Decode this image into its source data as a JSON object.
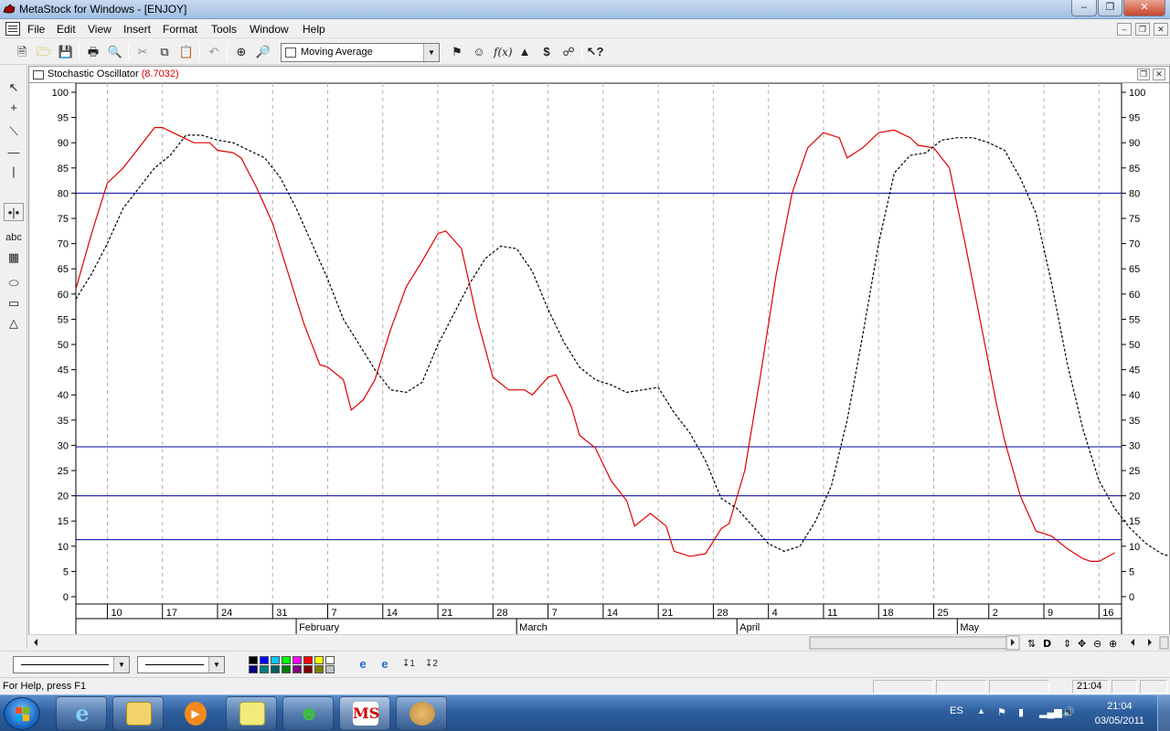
{
  "window": {
    "title": "MetaStock for Windows - [ENJOY]"
  },
  "menu": [
    "File",
    "Edit",
    "View",
    "Insert",
    "Format",
    "Tools",
    "Window",
    "Help"
  ],
  "toolbar": {
    "indicator_select": "Moving Average"
  },
  "chart_window": {
    "title": "Stochastic Oscillator",
    "value": "(8.7032)"
  },
  "chart_data": {
    "type": "line",
    "title": "Stochastic Oscillator",
    "ylim": [
      0,
      100
    ],
    "yticks": [
      0,
      5,
      10,
      15,
      20,
      25,
      30,
      35,
      40,
      45,
      50,
      55,
      60,
      65,
      70,
      75,
      80,
      85,
      90,
      95,
      100
    ],
    "xlim": [
      0,
      140
    ],
    "x_ticks": [
      {
        "x": 4,
        "label": "10"
      },
      {
        "x": 11,
        "label": "17"
      },
      {
        "x": 18,
        "label": "24"
      },
      {
        "x": 25,
        "label": "31"
      },
      {
        "x": 32,
        "label": "7"
      },
      {
        "x": 39,
        "label": "14"
      },
      {
        "x": 46,
        "label": "21"
      },
      {
        "x": 53,
        "label": "28"
      },
      {
        "x": 60,
        "label": "7"
      },
      {
        "x": 67,
        "label": "14"
      },
      {
        "x": 74,
        "label": "21"
      },
      {
        "x": 81,
        "label": "28"
      },
      {
        "x": 88,
        "label": "4"
      },
      {
        "x": 95,
        "label": "11"
      },
      {
        "x": 102,
        "label": "18"
      },
      {
        "x": 109,
        "label": "25"
      },
      {
        "x": 116,
        "label": "2"
      },
      {
        "x": 123,
        "label": "9"
      },
      {
        "x": 130,
        "label": "16"
      }
    ],
    "months": [
      {
        "x": 28,
        "label": "February"
      },
      {
        "x": 56,
        "label": "March"
      },
      {
        "x": 84,
        "label": "April"
      },
      {
        "x": 112,
        "label": "May"
      }
    ],
    "hlines": [
      {
        "y": 80,
        "color": "#0000a0"
      },
      {
        "y": 29.7,
        "color": "#0000a0"
      },
      {
        "y": 20,
        "color": "#0000a0"
      },
      {
        "y": 11.3,
        "color": "#0000a0"
      }
    ],
    "series": [
      {
        "style": "solid",
        "color": "#e00000",
        "points": [
          [
            0,
            61
          ],
          [
            2,
            72
          ],
          [
            4,
            82
          ],
          [
            6,
            85
          ],
          [
            8,
            89
          ],
          [
            10,
            93
          ],
          [
            11,
            93
          ],
          [
            13,
            91.5
          ],
          [
            15,
            90
          ],
          [
            17,
            90
          ],
          [
            18,
            88.5
          ],
          [
            20,
            88
          ],
          [
            21,
            87
          ],
          [
            23,
            81
          ],
          [
            25,
            74
          ],
          [
            27,
            64
          ],
          [
            29,
            54
          ],
          [
            31,
            46
          ],
          [
            32,
            45.5
          ],
          [
            34,
            43
          ],
          [
            35,
            37
          ],
          [
            36.5,
            39
          ],
          [
            38,
            43
          ],
          [
            40,
            53
          ],
          [
            42,
            61.5
          ],
          [
            44,
            66.5
          ],
          [
            46,
            72
          ],
          [
            47,
            72.5
          ],
          [
            49,
            69
          ],
          [
            51,
            55
          ],
          [
            53,
            43.5
          ],
          [
            55,
            41
          ],
          [
            57,
            41
          ],
          [
            58,
            40
          ],
          [
            60,
            43.5
          ],
          [
            61,
            44
          ],
          [
            63,
            37.5
          ],
          [
            64,
            32
          ],
          [
            66,
            29.5
          ],
          [
            68,
            23
          ],
          [
            70,
            19
          ],
          [
            71,
            14
          ],
          [
            73,
            16.5
          ],
          [
            75,
            14
          ],
          [
            76,
            9
          ],
          [
            78,
            8
          ],
          [
            80,
            8.5
          ],
          [
            82,
            13.5
          ],
          [
            83,
            14.5
          ],
          [
            85,
            25
          ],
          [
            87,
            44
          ],
          [
            89,
            64
          ],
          [
            91,
            80
          ],
          [
            93,
            89
          ],
          [
            95,
            92
          ],
          [
            97,
            91
          ],
          [
            98,
            87
          ],
          [
            100,
            89
          ],
          [
            102,
            92
          ],
          [
            104,
            92.5
          ],
          [
            106,
            91
          ],
          [
            107,
            89.5
          ],
          [
            109,
            89
          ],
          [
            111,
            85
          ],
          [
            113,
            70
          ],
          [
            115,
            54
          ],
          [
            117,
            38
          ],
          [
            118,
            31
          ],
          [
            120,
            20
          ],
          [
            122,
            13
          ],
          [
            124,
            12
          ],
          [
            126,
            9.5
          ],
          [
            128,
            7.5
          ],
          [
            129,
            7
          ],
          [
            130,
            7
          ],
          [
            132,
            8.7
          ]
        ]
      },
      {
        "style": "dashed",
        "color": "#000000",
        "points": [
          [
            0,
            59
          ],
          [
            2,
            64
          ],
          [
            4,
            70
          ],
          [
            6,
            77
          ],
          [
            8,
            81
          ],
          [
            10,
            85
          ],
          [
            12,
            87.5
          ],
          [
            14,
            91.5
          ],
          [
            16,
            91.5
          ],
          [
            18,
            90.5
          ],
          [
            20,
            90
          ],
          [
            22,
            88.5
          ],
          [
            24,
            87
          ],
          [
            26,
            83
          ],
          [
            28,
            77
          ],
          [
            30,
            70
          ],
          [
            32,
            63
          ],
          [
            34,
            55
          ],
          [
            36,
            50
          ],
          [
            38,
            45
          ],
          [
            40,
            41
          ],
          [
            42,
            40.5
          ],
          [
            44,
            42.5
          ],
          [
            46,
            50
          ],
          [
            48,
            56
          ],
          [
            50,
            62
          ],
          [
            52,
            67
          ],
          [
            54,
            69.5
          ],
          [
            56,
            69
          ],
          [
            58,
            64.5
          ],
          [
            60,
            57
          ],
          [
            62,
            50.5
          ],
          [
            64,
            45.5
          ],
          [
            66,
            43
          ],
          [
            68,
            42
          ],
          [
            70,
            40.5
          ],
          [
            72,
            41
          ],
          [
            74,
            41.5
          ],
          [
            76,
            36.5
          ],
          [
            78,
            32.5
          ],
          [
            80,
            27
          ],
          [
            82,
            19.5
          ],
          [
            84,
            17.5
          ],
          [
            86,
            14
          ],
          [
            88,
            10.5
          ],
          [
            90,
            9
          ],
          [
            92,
            10
          ],
          [
            94,
            15
          ],
          [
            96,
            22
          ],
          [
            98,
            35
          ],
          [
            100,
            52
          ],
          [
            102,
            70
          ],
          [
            104,
            84
          ],
          [
            106,
            87.5
          ],
          [
            108,
            88
          ],
          [
            110,
            90.5
          ],
          [
            112,
            91
          ],
          [
            114,
            91
          ],
          [
            116,
            90
          ],
          [
            118,
            88.5
          ],
          [
            120,
            83
          ],
          [
            122,
            76
          ],
          [
            124,
            62
          ],
          [
            126,
            46
          ],
          [
            128,
            33
          ],
          [
            130,
            23
          ],
          [
            132,
            17.5
          ],
          [
            134,
            13.5
          ],
          [
            136,
            10.5
          ],
          [
            138,
            8.5
          ],
          [
            139,
            8
          ]
        ]
      }
    ]
  },
  "statusbar": {
    "help": "For Help, press F1",
    "time": "21:04"
  },
  "taskbar": {
    "lang": "ES",
    "clock_time": "21:04",
    "clock_date": "03/05/2011",
    "ms_label": "MS"
  }
}
